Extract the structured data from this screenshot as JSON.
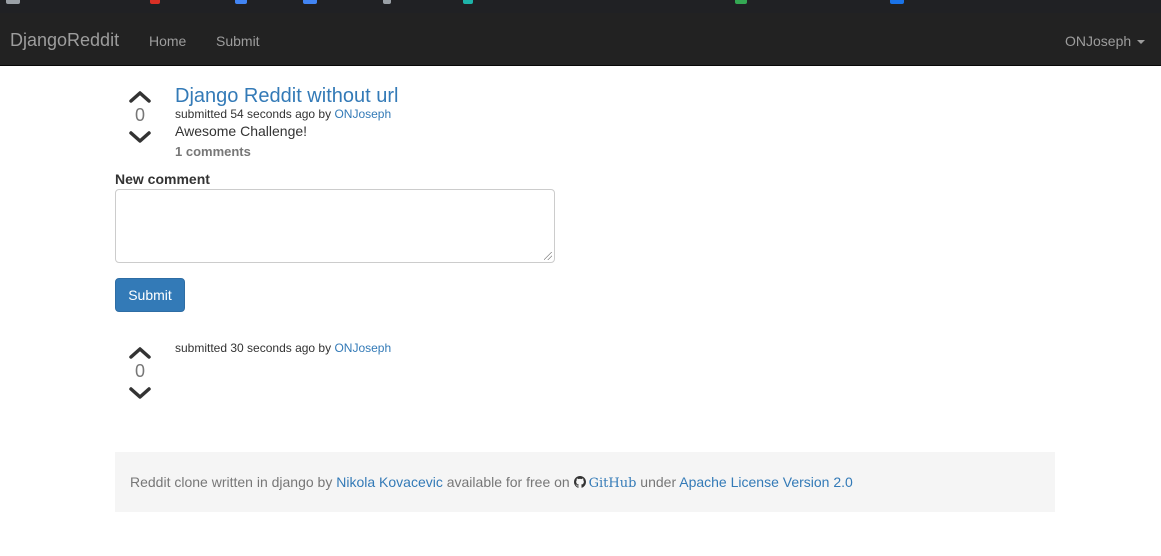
{
  "navbar": {
    "brand": "DjangoReddit",
    "links": [
      "Home",
      "Submit"
    ],
    "user": "ONJoseph"
  },
  "post": {
    "title": "Django Reddit without url",
    "votes": "0",
    "submitted_prefix": "submitted 54 seconds ago by",
    "author": "ONJoseph",
    "body": "Awesome Challenge!",
    "comments_link": "1 comments"
  },
  "comment_form": {
    "label": "New comment",
    "value": "",
    "submit_label": "Submit"
  },
  "comments": [
    {
      "votes": "0",
      "submitted_prefix": "submitted 30 seconds ago by",
      "author": "ONJoseph"
    }
  ],
  "footer": {
    "text_before": "Reddit clone written in django by",
    "author_link": "Nikola Kovacevic",
    "text_middle": "available for free on",
    "github_link": "GitHub",
    "text_under": "under",
    "license_link": "Apache License Version 2.0"
  },
  "colors": {
    "navbar_bg": "#222222",
    "link": "#337ab7",
    "button": "#337ab7",
    "footer_bg": "#f5f5f5"
  },
  "icons": [
    "chevron-up-icon",
    "chevron-down-icon",
    "caret-down-icon",
    "github-icon"
  ]
}
